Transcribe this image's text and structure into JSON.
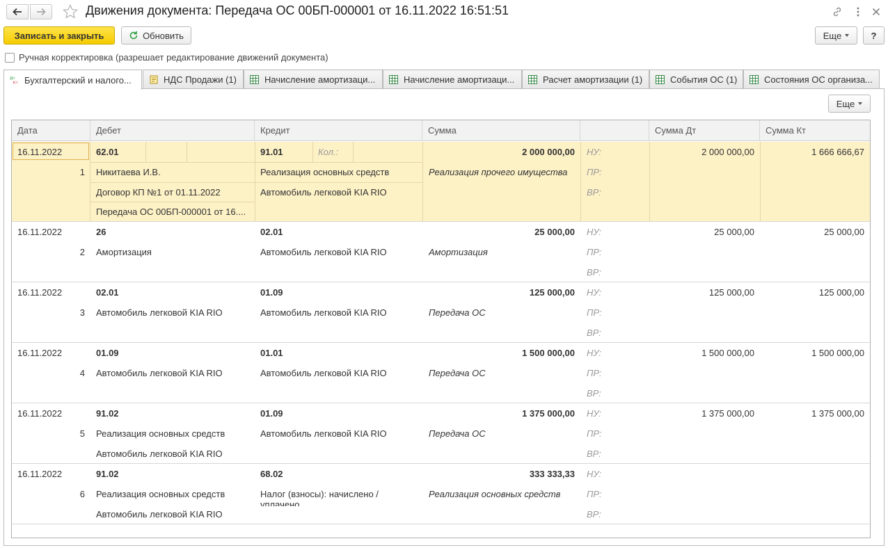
{
  "window": {
    "title": "Движения документа: Передача ОС 00БП-000001 от 16.11.2022 16:51:51"
  },
  "toolbar": {
    "save_close": "Записать и закрыть",
    "refresh": "Обновить",
    "more": "Еще",
    "help": "?"
  },
  "manual_edit": {
    "label": "Ручная корректировка (разрешает редактирование движений документа)",
    "checked": false
  },
  "tabs": [
    {
      "label": "Бухгалтерский и налого...",
      "icon": "accounting-dt-kt-icon",
      "active": true
    },
    {
      "label": "НДС Продажи (1)",
      "icon": "document-icon",
      "active": false
    },
    {
      "label": "Начисление амортизаци...",
      "icon": "table-icon",
      "active": false
    },
    {
      "label": "Начисление амортизаци...",
      "icon": "table-icon",
      "active": false
    },
    {
      "label": "Расчет амортизации (1)",
      "icon": "table-icon",
      "active": false
    },
    {
      "label": "События ОС (1)",
      "icon": "table-icon",
      "active": false
    },
    {
      "label": "Состояния ОС организа...",
      "icon": "table-icon",
      "active": false
    }
  ],
  "panel": {
    "more": "Еще"
  },
  "grid": {
    "columns": [
      "Дата",
      "Дебет",
      "Кредит",
      "Сумма",
      "",
      "Сумма Дт",
      "Сумма Кт"
    ],
    "qty_label": "Кол.:",
    "acc_labels": [
      "НУ:",
      "ПР:",
      "ВР:"
    ],
    "rows": [
      {
        "date": "16.11.2022",
        "num": "1",
        "debit": "62.01",
        "debit_sub": [
          "Никитаева И.В.",
          "Договор КП №1 от 01.11.2022",
          "Передача ОС 00БП-000001 от 16...."
        ],
        "credit": "91.01",
        "credit_sub": [
          "Реализация основных средств",
          "Автомобиль легковой KIA RIO"
        ],
        "sum": "2 000 000,00",
        "content": "Реализация прочего имущества",
        "sum_dt": "2 000 000,00",
        "sum_kt": "1 666 666,67"
      },
      {
        "date": "16.11.2022",
        "num": "2",
        "debit": "26",
        "debit_sub": [
          "Амортизация"
        ],
        "credit": "02.01",
        "credit_sub": [
          "Автомобиль легковой KIA RIO"
        ],
        "sum": "25 000,00",
        "content": "Амортизация",
        "sum_dt": "25 000,00",
        "sum_kt": "25 000,00"
      },
      {
        "date": "16.11.2022",
        "num": "3",
        "debit": "02.01",
        "debit_sub": [
          "Автомобиль легковой KIA RIO"
        ],
        "credit": "01.09",
        "credit_sub": [
          "Автомобиль легковой KIA RIO"
        ],
        "sum": "125 000,00",
        "content": "Передача ОС",
        "sum_dt": "125 000,00",
        "sum_kt": "125 000,00"
      },
      {
        "date": "16.11.2022",
        "num": "4",
        "debit": "01.09",
        "debit_sub": [
          "Автомобиль легковой KIA RIO"
        ],
        "credit": "01.01",
        "credit_sub": [
          "Автомобиль легковой KIA RIO"
        ],
        "sum": "1 500 000,00",
        "content": "Передача ОС",
        "sum_dt": "1 500 000,00",
        "sum_kt": "1 500 000,00"
      },
      {
        "date": "16.11.2022",
        "num": "5",
        "debit": "91.02",
        "debit_sub": [
          "Реализация основных средств",
          "Автомобиль легковой KIA RIO"
        ],
        "credit": "01.09",
        "credit_sub": [
          "Автомобиль легковой KIA RIO"
        ],
        "sum": "1 375 000,00",
        "content": "Передача ОС",
        "sum_dt": "1 375 000,00",
        "sum_kt": "1 375 000,00"
      },
      {
        "date": "16.11.2022",
        "num": "6",
        "debit": "91.02",
        "debit_sub": [
          "Реализация основных средств",
          "Автомобиль легковой KIA RIO"
        ],
        "credit": "68.02",
        "credit_sub": [
          "Налог (взносы): начислено / уплачено"
        ],
        "sum": "333 333,33",
        "content": "Реализация основных средств",
        "sum_dt": "",
        "sum_kt": ""
      }
    ]
  },
  "colors": {
    "accent": "#f5cc00",
    "selected_row": "#fdf1c6",
    "grid_header": "#f2f2f2"
  }
}
